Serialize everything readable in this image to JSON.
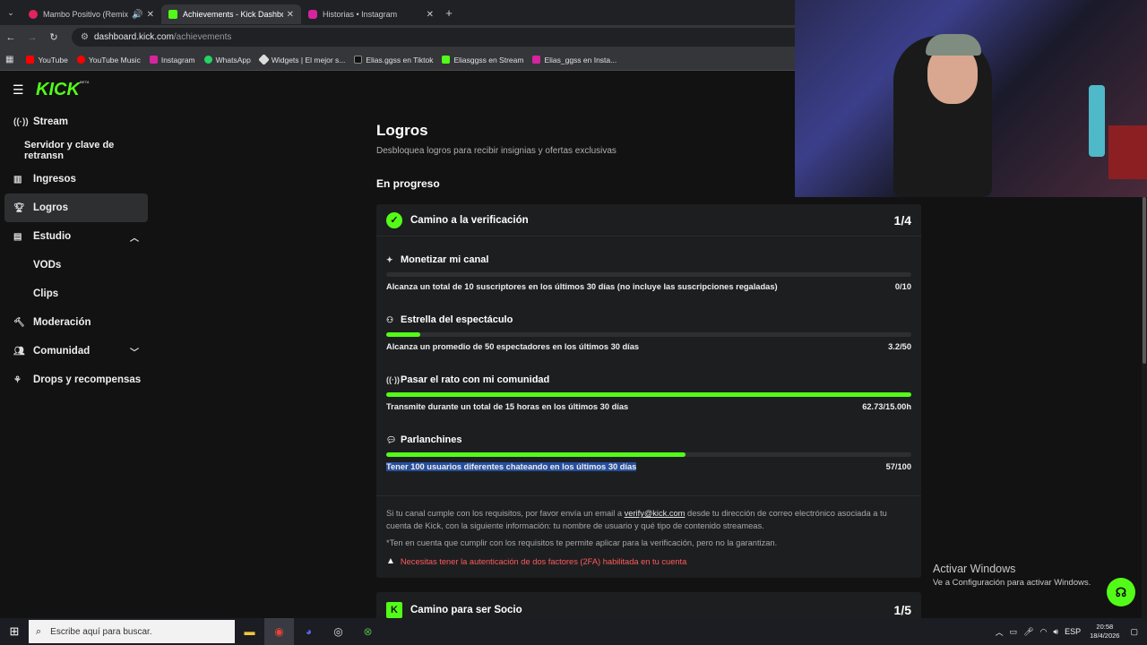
{
  "browser": {
    "tabs": [
      {
        "title": "Mambo Positivo (Remix) | Y",
        "color": "#e0245e"
      },
      {
        "title": "Achievements - Kick Dashboard",
        "color": "#53fc18"
      },
      {
        "title": "Historias • Instagram",
        "color": "#d6249f"
      }
    ],
    "url_host": "dashboard.kick.com",
    "url_path": "/achievements",
    "bookmarks": [
      {
        "label": "YouTube",
        "color": "#ff0000"
      },
      {
        "label": "YouTube Music",
        "color": "#ff0000"
      },
      {
        "label": "Instagram",
        "color": "#d6249f"
      },
      {
        "label": "WhatsApp",
        "color": "#25d366"
      },
      {
        "label": "Widgets | El mejor s...",
        "color": "#dddddd"
      },
      {
        "label": "Elias.ggss en Tiktok",
        "color": "#111111"
      },
      {
        "label": "Eliasggss en Stream",
        "color": "#53fc18"
      },
      {
        "label": "Elias_ggss en Insta...",
        "color": "#d6249f"
      }
    ]
  },
  "sidebar": {
    "logo": "KICK",
    "beta": "BETA",
    "items": [
      {
        "label": "Stream",
        "icon": "broadcast-icon"
      },
      {
        "label": "Servidor y clave de retransn",
        "icon": ""
      },
      {
        "label": "Ingresos",
        "icon": "chart-icon"
      },
      {
        "label": "Logros",
        "icon": "trophy-icon"
      },
      {
        "label": "Estudio",
        "icon": "studio-icon"
      },
      {
        "label": "VODs",
        "icon": ""
      },
      {
        "label": "Clips",
        "icon": ""
      },
      {
        "label": "Moderación",
        "icon": "hammer-icon"
      },
      {
        "label": "Comunidad",
        "icon": "community-icon"
      },
      {
        "label": "Drops y recompensas",
        "icon": "drops-icon"
      }
    ]
  },
  "main": {
    "title": "Logros",
    "subtitle": "Desbloquea logros para recibir insignias y ofertas exclusivas",
    "section": "En progreso",
    "card": {
      "title": "Camino a la verificación",
      "count": "1/4",
      "tasks": [
        {
          "title": "Monetizar mi canal",
          "desc": "Alcanza un total de 10 suscriptores en los últimos 30 días (no incluye las suscripciones regaladas)",
          "value": "0/10",
          "progress": 0.0
        },
        {
          "title": "Estrella del espectáculo",
          "desc": "Alcanza un promedio de 50 espectadores en los últimos 30 días",
          "value": "3.2/50",
          "progress": 0.064
        },
        {
          "title": "Pasar el rato con mi comunidad",
          "desc": "Transmite durante un total de 15 horas en los últimos 30 días",
          "value": "62.73/15.00h",
          "progress": 1.0
        },
        {
          "title": "Parlanchines",
          "desc": "Tener 100 usuarios diferentes chateando en los últimos 30 días",
          "value": "57/100",
          "progress": 0.57
        }
      ],
      "footer_pre": "Si tu canal cumple con los requisitos, por favor envía un email a ",
      "footer_email": "verify@kick.com",
      "footer_post": " desde tu dirección de correo electrónico asociada a tu cuenta de Kick, con la siguiente información: tu nombre de usuario y qué tipo de contenido streameas.",
      "footer_note": "*Ten en cuenta que cumplir con los requisitos te permite aplicar para la verificación, pero no la garantizan.",
      "warning": "Necesitas tener la autenticación de dos factores (2FA) habilitada en tu cuenta"
    },
    "card2": {
      "title": "Camino para ser Socio",
      "count": "1/5"
    }
  },
  "windows": {
    "activate_title": "Activar Windows",
    "activate_sub": "Ve a Configuración para activar Windows.",
    "search_placeholder": "Escribe aquí para buscar.",
    "lang": "ESP",
    "time": "20:58",
    "date": "18/4/2026"
  },
  "colors": {
    "accent": "#53fc18",
    "warning": "#ff5a5a"
  }
}
